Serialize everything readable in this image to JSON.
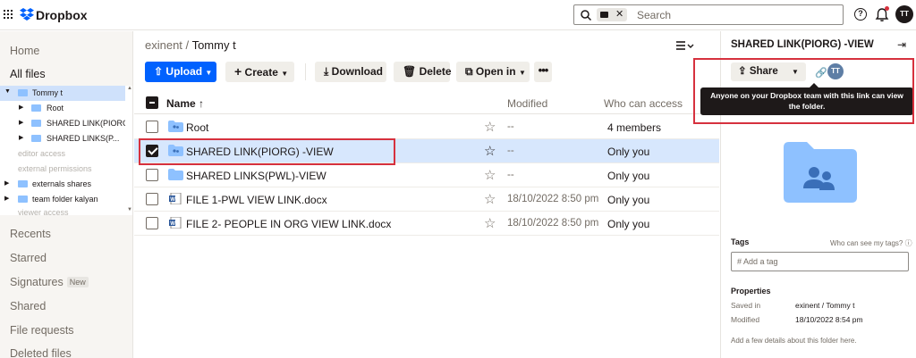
{
  "topbar": {
    "brand": "Dropbox",
    "search_placeholder": "Search",
    "avatar_initials": "TT"
  },
  "sidebar": {
    "nav": [
      {
        "label": "Home"
      },
      {
        "label": "All files"
      },
      {
        "label": "Recents"
      },
      {
        "label": "Starred"
      },
      {
        "label": "Signatures",
        "badge": "New"
      },
      {
        "label": "Shared"
      },
      {
        "label": "File requests"
      },
      {
        "label": "Deleted files"
      }
    ],
    "tree": [
      {
        "label": "Tommy t"
      },
      {
        "label": "Root"
      },
      {
        "label": "SHARED LINK(PIORG..."
      },
      {
        "label": "SHARED LINKS(P..."
      },
      {
        "label": "editor access"
      },
      {
        "label": "external permissions"
      },
      {
        "label": "externals shares"
      },
      {
        "label": "team folder kalyan"
      },
      {
        "label": "viewer access"
      }
    ]
  },
  "main": {
    "breadcrumb_parent": "exinent",
    "breadcrumb_sep": "/",
    "breadcrumb_current": "Tommy t",
    "toolbar": {
      "upload": "Upload",
      "create": "Create",
      "download": "Download",
      "delete": "Delete",
      "open_in": "Open in",
      "more": "•••"
    },
    "columns": {
      "name": "Name",
      "sort_arrow": "↑",
      "modified": "Modified",
      "who": "Who can access"
    },
    "rows": [
      {
        "name": "Root",
        "modified": "--",
        "who": "4 members"
      },
      {
        "name": "SHARED LINK(PIORG) -VIEW",
        "modified": "--",
        "who": "Only you"
      },
      {
        "name": "SHARED LINKS(PWL)-VIEW",
        "modified": "--",
        "who": "Only you"
      },
      {
        "name": "FILE 1-PWL VIEW LINK.docx",
        "modified": "18/10/2022 8:50 pm",
        "who": "Only you"
      },
      {
        "name": "FILE 2- PEOPLE IN ORG VIEW LINK.docx",
        "modified": "18/10/2022 8:50 pm",
        "who": "Only you"
      }
    ]
  },
  "panel": {
    "title": "SHARED LINK(PIORG) -VIEW",
    "share": "Share",
    "avatar": "TT",
    "tooltip": "Anyone on your Dropbox team with this link can view the folder.",
    "tags_label": "Tags",
    "tags_help": "Who can see my tags?",
    "tag_placeholder": "# Add a tag",
    "properties_label": "Properties",
    "saved_in_key": "Saved in",
    "saved_in_value": "exinent  /  Tommy t",
    "modified_key": "Modified",
    "modified_value": "18/10/2022 8:54 pm",
    "add_details": "Add a few details about this folder here."
  },
  "colors": {
    "accent": "#0061fe",
    "highlight_box": "#d6313e",
    "folder": "#8ec1ff",
    "selected_row": "#d7e7fd"
  }
}
